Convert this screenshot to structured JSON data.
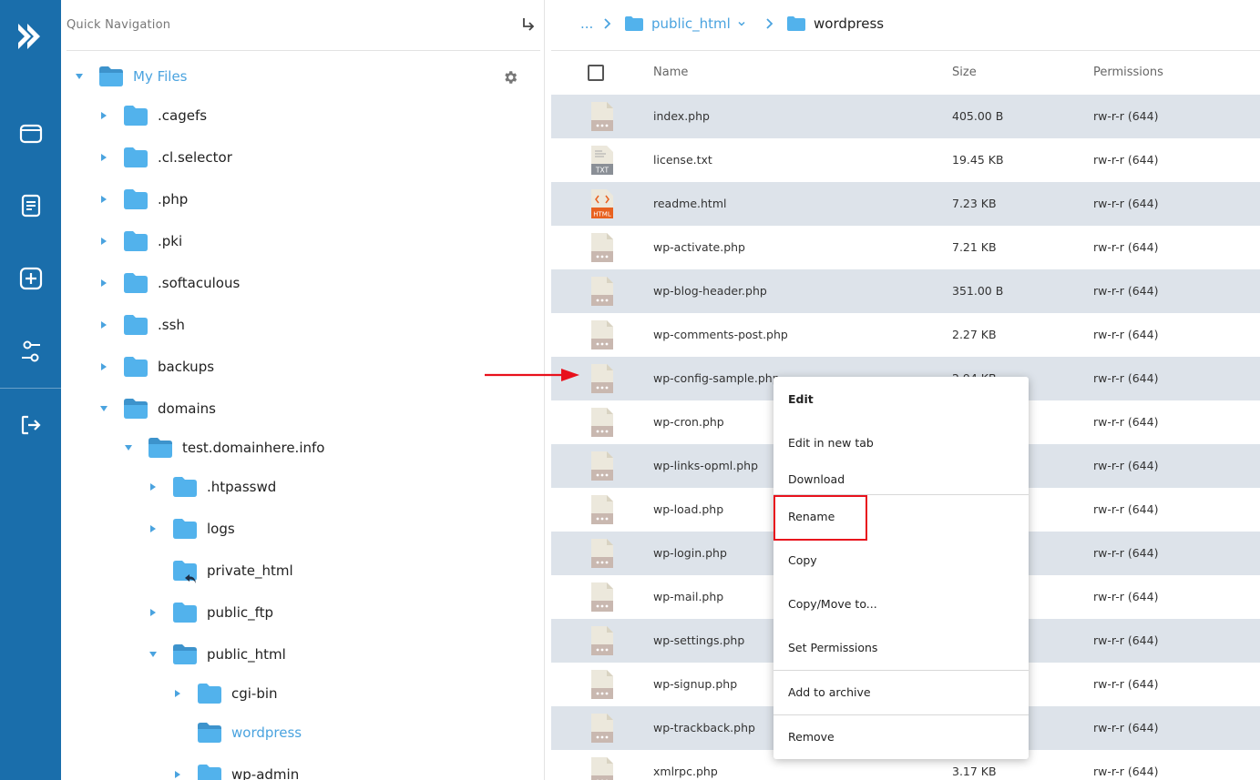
{
  "quick_nav": {
    "placeholder": "Quick Navigation"
  },
  "tree": {
    "root": {
      "label": "My Files"
    },
    "items": [
      {
        "label": ".cagefs"
      },
      {
        "label": ".cl.selector"
      },
      {
        "label": ".php"
      },
      {
        "label": ".pki"
      },
      {
        "label": ".softaculous"
      },
      {
        "label": ".ssh"
      },
      {
        "label": "backups"
      },
      {
        "label": "domains"
      },
      {
        "label": "test.domainhere.info"
      },
      {
        "label": ".htpasswd"
      },
      {
        "label": "logs"
      },
      {
        "label": "private_html"
      },
      {
        "label": "public_ftp"
      },
      {
        "label": "public_html"
      },
      {
        "label": "cgi-bin"
      },
      {
        "label": "wordpress"
      },
      {
        "label": "wp-admin"
      }
    ]
  },
  "breadcrumb": {
    "ellipsis": "...",
    "items": [
      {
        "label": "public_html"
      },
      {
        "label": "wordpress"
      }
    ]
  },
  "table": {
    "columns": {
      "name": "Name",
      "size": "Size",
      "permissions": "Permissions"
    },
    "rows": [
      {
        "name": "index.php",
        "size": "405.00 B",
        "perm": "rw-r-r (644)",
        "icon": "php-file-icon"
      },
      {
        "name": "license.txt",
        "size": "19.45 KB",
        "perm": "rw-r-r (644)",
        "icon": "txt-file-icon"
      },
      {
        "name": "readme.html",
        "size": "7.23 KB",
        "perm": "rw-r-r (644)",
        "icon": "html-file-icon"
      },
      {
        "name": "wp-activate.php",
        "size": "7.21 KB",
        "perm": "rw-r-r (644)",
        "icon": "php-file-icon"
      },
      {
        "name": "wp-blog-header.php",
        "size": "351.00 B",
        "perm": "rw-r-r (644)",
        "icon": "php-file-icon"
      },
      {
        "name": "wp-comments-post.php",
        "size": "2.27 KB",
        "perm": "rw-r-r (644)",
        "icon": "php-file-icon"
      },
      {
        "name": "wp-config-sample.php",
        "size": "2.94 KB",
        "perm": "rw-r-r (644)",
        "icon": "php-file-icon"
      },
      {
        "name": "wp-cron.php",
        "size": "",
        "perm": "rw-r-r (644)",
        "icon": "php-file-icon"
      },
      {
        "name": "wp-links-opml.php",
        "size": "",
        "perm": "rw-r-r (644)",
        "icon": "php-file-icon"
      },
      {
        "name": "wp-load.php",
        "size": "",
        "perm": "rw-r-r (644)",
        "icon": "php-file-icon"
      },
      {
        "name": "wp-login.php",
        "size": "",
        "perm": "rw-r-r (644)",
        "icon": "php-file-icon"
      },
      {
        "name": "wp-mail.php",
        "size": "",
        "perm": "rw-r-r (644)",
        "icon": "php-file-icon"
      },
      {
        "name": "wp-settings.php",
        "size": "",
        "perm": "rw-r-r (644)",
        "icon": "php-file-icon"
      },
      {
        "name": "wp-signup.php",
        "size": "",
        "perm": "rw-r-r (644)",
        "icon": "php-file-icon"
      },
      {
        "name": "wp-trackback.php",
        "size": "",
        "perm": "rw-r-r (644)",
        "icon": "php-file-icon"
      },
      {
        "name": "xmlrpc.php",
        "size": "3.17 KB",
        "perm": "rw-r-r (644)",
        "icon": "php-file-icon"
      }
    ]
  },
  "context_menu": {
    "items": [
      {
        "label": "Edit"
      },
      {
        "label": "Edit in new tab"
      },
      {
        "label": "Download"
      },
      {
        "label": "Rename"
      },
      {
        "label": "Copy"
      },
      {
        "label": "Copy/Move to..."
      },
      {
        "label": "Set Permissions"
      },
      {
        "label": "Add to archive"
      },
      {
        "label": "Remove"
      }
    ]
  },
  "colors": {
    "rail": "#1a6eab",
    "folder": "#52b2ec",
    "active_text": "#4aa3df",
    "row_alt": "#dde3ea",
    "highlight": "#e8111c"
  }
}
